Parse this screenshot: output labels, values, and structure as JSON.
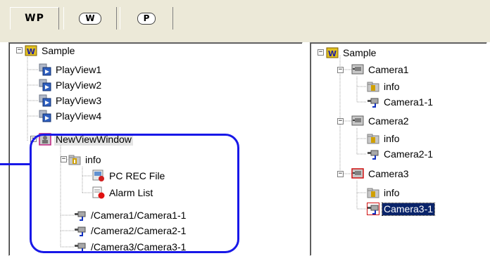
{
  "tabs": [
    {
      "label": "WP",
      "active": true
    },
    {
      "label": "W",
      "active": false
    },
    {
      "label": "P",
      "active": false
    }
  ],
  "left_tree": {
    "root": {
      "label": "Sample",
      "icon": "w-root-icon"
    },
    "playviews": [
      "PlayView1",
      "PlayView2",
      "PlayView3",
      "PlayView4"
    ],
    "view_window": {
      "label": "NewViewWindow",
      "icon": "view-window-icon"
    },
    "info": {
      "label": "info",
      "icon": "folder-info-icon"
    },
    "info_children": [
      "PC REC File",
      "Alarm List"
    ],
    "cameras": [
      "/Camera1/Camera1-1",
      "/Camera2/Camera2-1",
      "/Camera3/Camera3-1"
    ]
  },
  "right_tree": {
    "root": {
      "label": "Sample"
    },
    "groups": [
      {
        "label": "Camera1",
        "info": "info",
        "stream": "Camera1-1"
      },
      {
        "label": "Camera2",
        "info": "info",
        "stream": "Camera2-1"
      },
      {
        "label": "Camera3",
        "info": "info",
        "stream": "Camera3-1"
      }
    ],
    "selected": "Camera3-1"
  },
  "colors": {
    "callout": "#1818e8",
    "selection": "#0a246a",
    "chrome": "#ece9d8"
  }
}
